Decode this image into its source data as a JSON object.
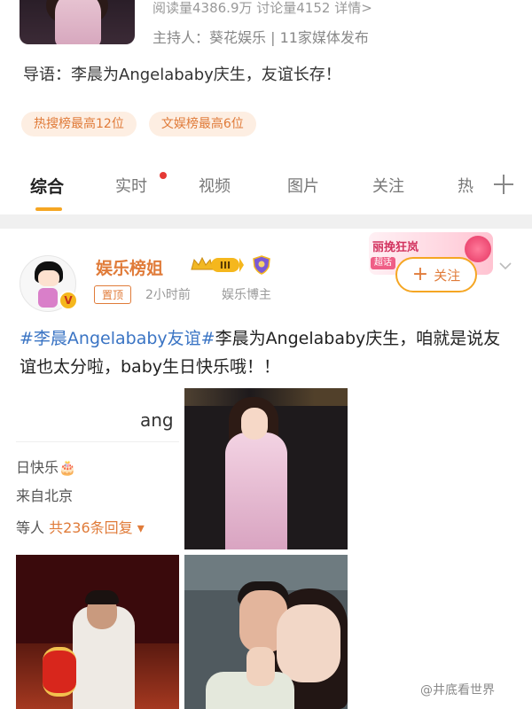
{
  "topic": {
    "stats": "阅读量4386.9万 讨论量4152 详情>",
    "host": "主持人：葵花娱乐 | 11家媒体发布",
    "guide": "导语：李晨为Angelababy庆生，友谊长存！",
    "rank_tags": [
      "热搜榜最高12位",
      "文娱榜最高6位"
    ]
  },
  "tabs": {
    "items": [
      "综合",
      "实时",
      "视频",
      "图片",
      "关注",
      "热"
    ],
    "active": "综合"
  },
  "post": {
    "username": "娱乐榜姐",
    "level_badge": "III",
    "pin_label": "置顶",
    "time": "2小时前",
    "source": "娱乐博主",
    "follow_label": "关注",
    "promo_title": "丽挽狂岚",
    "promo_tag": "超话",
    "hashtag": "#李晨Angelababy友谊#",
    "text": "李晨为Angelababy庆生，咱就是说友谊也太分啦，baby生日快乐哦！！",
    "image1": {
      "ang_text": "ang",
      "line1": "日快乐🎂",
      "line2": "来自北京",
      "line3_prefix": "等人",
      "line3_reply": "共236条回复 ▾"
    }
  },
  "watermark": "@井底看世界",
  "colors": {
    "accent": "#f5a623",
    "brand_orange": "#e07b39",
    "hashtag_blue": "#3a74c4",
    "notification_red": "#e53935"
  }
}
